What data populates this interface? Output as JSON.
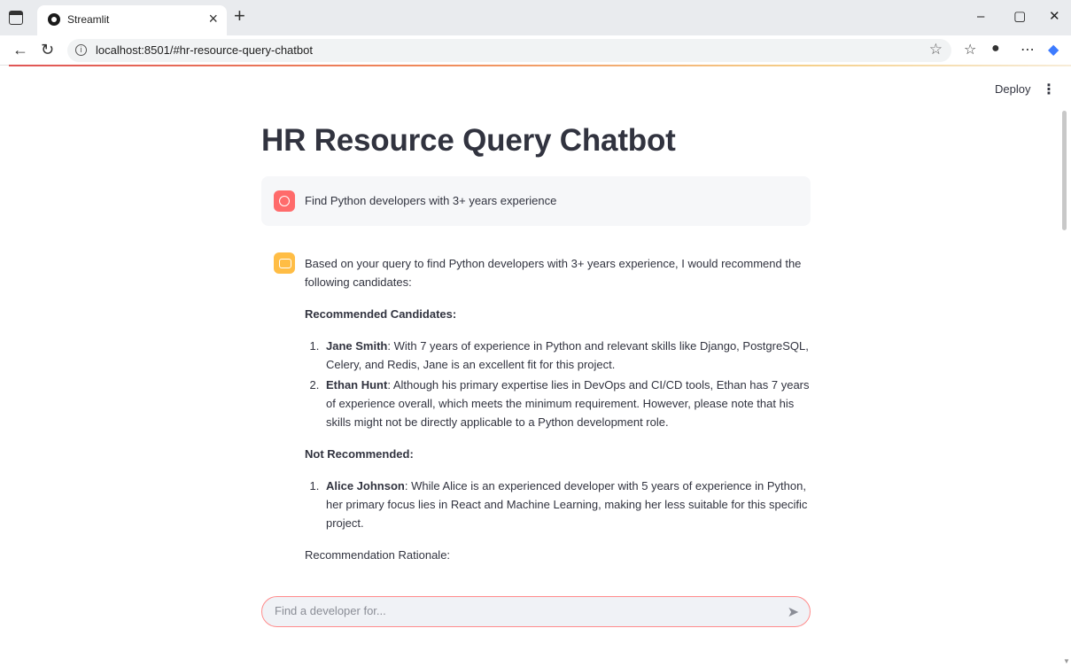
{
  "browser": {
    "tab_title": "Streamlit",
    "tab_close": "×",
    "new_tab": "+",
    "url": "localhost:8501/#hr-resource-query-chatbot",
    "win_min": "–",
    "win_max": "▢",
    "win_close": "✕"
  },
  "header": {
    "deploy_label": "Deploy",
    "menu_glyph": "⋮"
  },
  "page": {
    "title": "HR Resource Query Chatbot"
  },
  "user_message": {
    "text": "Find Python developers with 3+ years experience"
  },
  "assistant_message": {
    "intro": "Based on your query to find Python developers with 3+ years experience, I would recommend the following candidates:",
    "recommended_heading": "Recommended Candidates:",
    "recommended": [
      {
        "name": "Jane Smith",
        "text": ": With 7 years of experience in Python and relevant skills like Django, PostgreSQL, Celery, and Redis, Jane is an excellent fit for this project."
      },
      {
        "name": "Ethan Hunt",
        "text": ": Although his primary expertise lies in DevOps and CI/CD tools, Ethan has 7 years of experience overall, which meets the minimum requirement. However, please note that his skills might not be directly applicable to a Python development role."
      }
    ],
    "not_recommended_heading": "Not Recommended:",
    "not_recommended": [
      {
        "name": "Alice Johnson",
        "text": ": While Alice is an experienced developer with 5 years of experience in Python, her primary focus lies in React and Machine Learning, making her less suitable for this specific project."
      }
    ],
    "rationale_heading": "Recommendation Rationale:"
  },
  "chat_input": {
    "placeholder": "Find a developer for...",
    "value": ""
  }
}
